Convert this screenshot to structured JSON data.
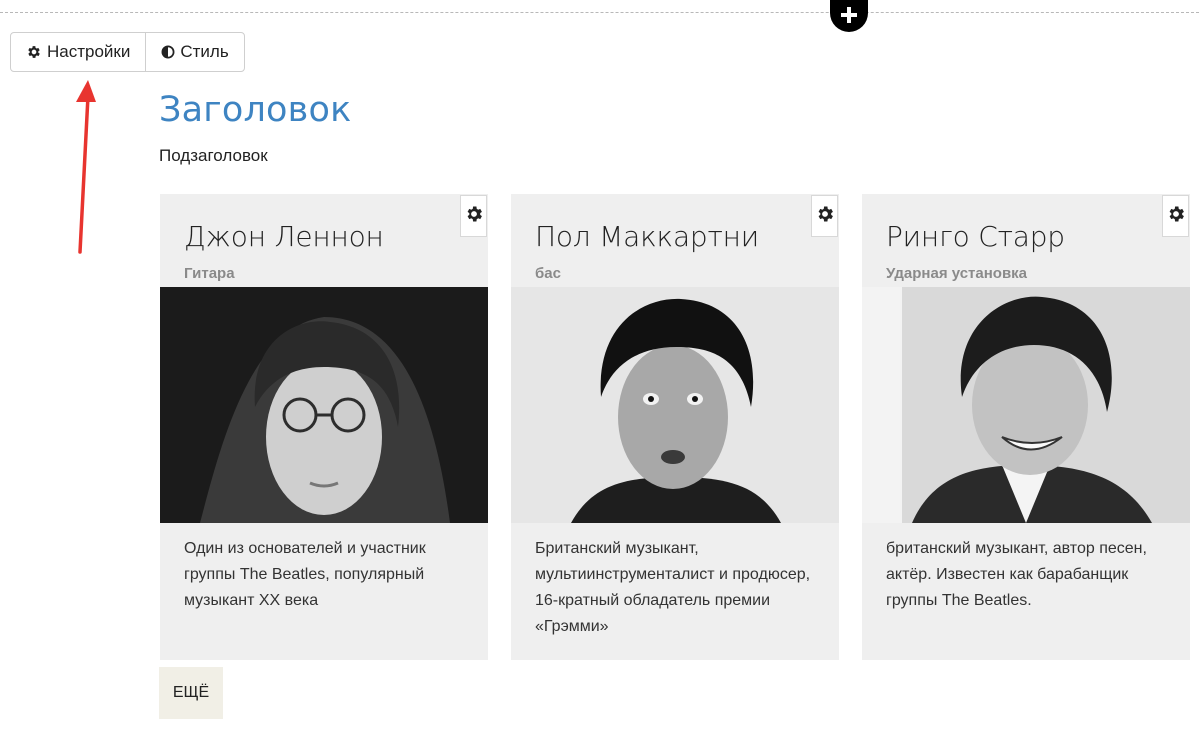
{
  "toolbar": {
    "settings_label": "Настройки",
    "style_label": "Стиль"
  },
  "block": {
    "title": "Заголовок",
    "subtitle": "Подзаголовок",
    "more_label": "ЕЩЁ"
  },
  "cards": [
    {
      "name": "Джон Леннон",
      "role": "Гитара",
      "description": "Один из основателей и участник группы The Beatles, популярный музыкант XX века"
    },
    {
      "name": "Пол Маккартни",
      "role": "бас",
      "description": "Британский музыкант, мультиинструменталист и продюсер, 16-кратный обладатель премии «Грэмми»"
    },
    {
      "name": "Ринго Старр",
      "role": "Ударная установка",
      "description": "британский музыкант, автор песен, актёр. Известен как барабанщик группы The Beatles."
    }
  ],
  "icons": {
    "add": "plus-circle-icon",
    "settings": "gear-icon",
    "style": "half-circle-contrast-icon",
    "card_settings": "gear-icon",
    "annotation": "red-arrow"
  },
  "colors": {
    "title": "#3e84c2",
    "arrow": "#e8342f",
    "card_bg": "#efefef",
    "more_bg": "#f1efe6"
  }
}
